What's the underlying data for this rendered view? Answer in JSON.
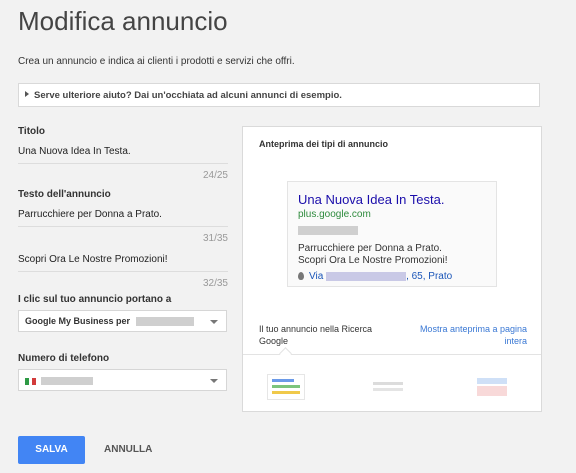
{
  "page": {
    "title": "Modifica annuncio",
    "subtitle": "Crea un annuncio e indica ai clienti i prodotti e servizi che offri.",
    "help": "Serve ulteriore aiuto? Dai un'occhiata ad alcuni annunci di esempio."
  },
  "form": {
    "title_label": "Titolo",
    "title_value": "Una Nuova Idea In Testa.",
    "title_counter": "24/25",
    "text_label": "Testo dell'annuncio",
    "text_line1": "Parrucchiere per Donna a Prato.",
    "text_line1_counter": "31/35",
    "text_line2": "Scopri Ora Le Nostre Promozioni!",
    "text_line2_counter": "32/35",
    "destination_label": "I clic sul tuo annuncio portano a",
    "destination_value": "Google My Business per",
    "phone_label": "Numero di telefono"
  },
  "preview": {
    "heading": "Anteprima dei tipi di annuncio",
    "ad_headline": "Una Nuova Idea In Testa.",
    "ad_url": "plus.google.com",
    "ad_line1": "Parrucchiere per Donna a Prato.",
    "ad_line2": "Scopri Ora Le Nostre Promozioni!",
    "ad_location_prefix": "Via",
    "ad_location_suffix": ", 65, Prato",
    "search_label": "Il tuo annuncio nella Ricerca Google",
    "full_preview_link": "Mostra anteprima a pagina intera"
  },
  "actions": {
    "save": "SALVA",
    "cancel": "ANNULLA"
  },
  "colors": {
    "accent": "#4285f4",
    "link": "#1a0dab",
    "url_green": "#2e8b3d"
  }
}
